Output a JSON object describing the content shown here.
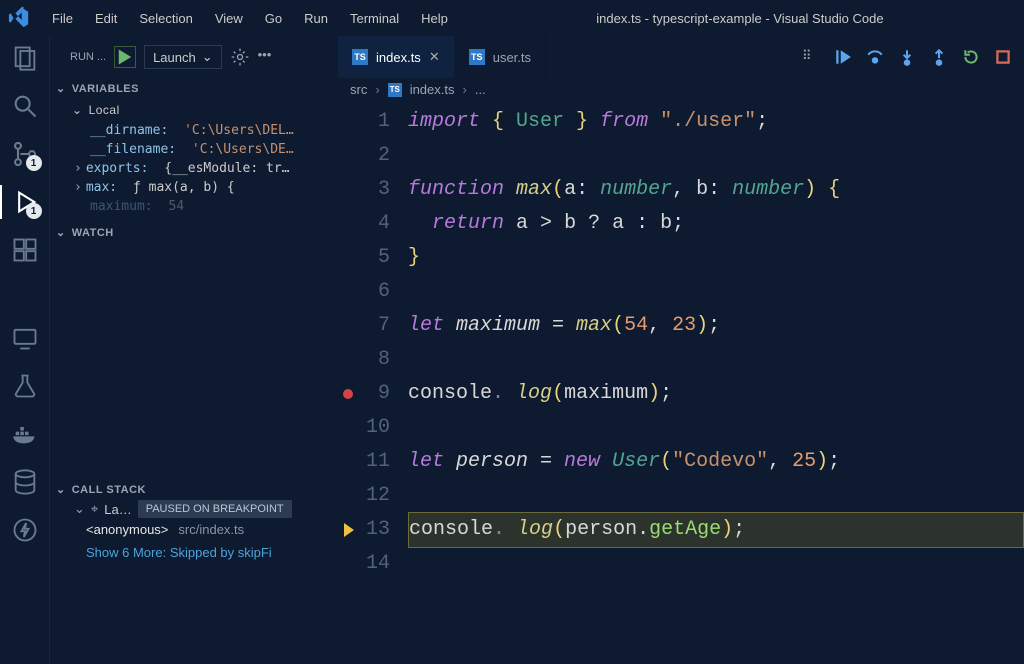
{
  "window_title": "index.ts - typescript-example - Visual Studio Code",
  "menubar": [
    "File",
    "Edit",
    "Selection",
    "View",
    "Go",
    "Run",
    "Terminal",
    "Help"
  ],
  "activity_badges": {
    "scm": "1",
    "debug": "1"
  },
  "sidebar": {
    "run_label": "RUN ...",
    "launch_label": "Launch",
    "sections": {
      "variables": "VARIABLES",
      "local": "Local",
      "watch": "WATCH",
      "callstack": "CALL STACK"
    },
    "vars": {
      "dirname_k": "__dirname:",
      "dirname_v": "'C:\\Users\\DEL…",
      "filename_k": "__filename:",
      "filename_v": "'C:\\Users\\DE…",
      "exports_k": "exports:",
      "exports_v": "{__esModule: tr…",
      "max_k": "max:",
      "max_v": "ƒ max(a, b) {",
      "maximum_k": "maximum:",
      "maximum_v": "54"
    },
    "callstack": {
      "thread": "La…",
      "paused": "PAUSED ON BREAKPOINT",
      "frame": "<anonymous>",
      "frame_path": "src/index.ts",
      "showmore": "Show 6 More: Skipped by skipFi"
    }
  },
  "tabs": {
    "index": "index.ts",
    "user": "user.ts"
  },
  "breadcrumb": {
    "src": "src",
    "file": "index.ts",
    "more": "..."
  },
  "code_lines": {
    "l1": {
      "n": "1",
      "tokens": [
        [
          "k",
          "import "
        ],
        [
          "p",
          "{ "
        ],
        [
          "t",
          "User"
        ],
        [
          "p",
          " } "
        ],
        [
          "k",
          "from "
        ],
        [
          "s",
          "\"./user\""
        ],
        [
          "op",
          ";"
        ]
      ]
    },
    "l2": {
      "n": "2",
      "tokens": []
    },
    "l3": {
      "n": "3",
      "tokens": [
        [
          "k",
          "function "
        ],
        [
          "fn",
          "max"
        ],
        [
          "p",
          "("
        ],
        [
          "v",
          "a"
        ],
        [
          "op",
          ": "
        ],
        [
          "t-i",
          "number"
        ],
        [
          "op",
          ", "
        ],
        [
          "v",
          "b"
        ],
        [
          "op",
          ": "
        ],
        [
          "t-i",
          "number"
        ],
        [
          "p",
          ") {"
        ]
      ]
    },
    "l4": {
      "n": "4",
      "tokens": [
        [
          "v",
          "  "
        ],
        [
          "ret",
          "return "
        ],
        [
          "v",
          "a"
        ],
        [
          "op",
          " > "
        ],
        [
          "v",
          "b"
        ],
        [
          "op",
          " ? "
        ],
        [
          "v",
          "a"
        ],
        [
          "op",
          " : "
        ],
        [
          "v",
          "b"
        ],
        [
          "op",
          ";"
        ]
      ]
    },
    "l5": {
      "n": "5",
      "tokens": [
        [
          "p",
          "}"
        ]
      ]
    },
    "l6": {
      "n": "6",
      "tokens": []
    },
    "l7": {
      "n": "7",
      "tokens": [
        [
          "k",
          "let "
        ],
        [
          "vi",
          "maximum"
        ],
        [
          "op",
          " = "
        ],
        [
          "fn",
          "max"
        ],
        [
          "p",
          "("
        ],
        [
          "n",
          "54"
        ],
        [
          "op",
          ", "
        ],
        [
          "n",
          "23"
        ],
        [
          "p",
          ")"
        ],
        [
          "op",
          ";"
        ]
      ]
    },
    "l8": {
      "n": "8",
      "tokens": []
    },
    "l9": {
      "n": "9",
      "tokens": [
        [
          "v",
          "console"
        ],
        [
          "dot",
          "."
        ],
        [
          "v",
          " "
        ],
        [
          "fn",
          "log"
        ],
        [
          "p",
          "("
        ],
        [
          "v",
          "maximum"
        ],
        [
          "p",
          ")"
        ],
        [
          "op",
          ";"
        ]
      ]
    },
    "l10": {
      "n": "10",
      "tokens": []
    },
    "l11": {
      "n": "11",
      "tokens": [
        [
          "k",
          "let "
        ],
        [
          "vi",
          "person"
        ],
        [
          "op",
          " = "
        ],
        [
          "k",
          "new "
        ],
        [
          "t-i",
          "User"
        ],
        [
          "p",
          "("
        ],
        [
          "s",
          "\"Codevo\""
        ],
        [
          "op",
          ", "
        ],
        [
          "n",
          "25"
        ],
        [
          "p",
          ")"
        ],
        [
          "op",
          ";"
        ]
      ]
    },
    "l12": {
      "n": "12",
      "tokens": []
    },
    "l13": {
      "n": "13",
      "tokens": [
        [
          "v",
          "console"
        ],
        [
          "dot",
          "."
        ],
        [
          "v",
          " "
        ],
        [
          "fn",
          "log"
        ],
        [
          "p",
          "("
        ],
        [
          "v",
          "person"
        ],
        [
          "op",
          "."
        ],
        [
          "obj",
          "getAge"
        ],
        [
          "p",
          ")"
        ],
        [
          "op",
          ";"
        ]
      ]
    },
    "l14": {
      "n": "14",
      "tokens": []
    }
  }
}
